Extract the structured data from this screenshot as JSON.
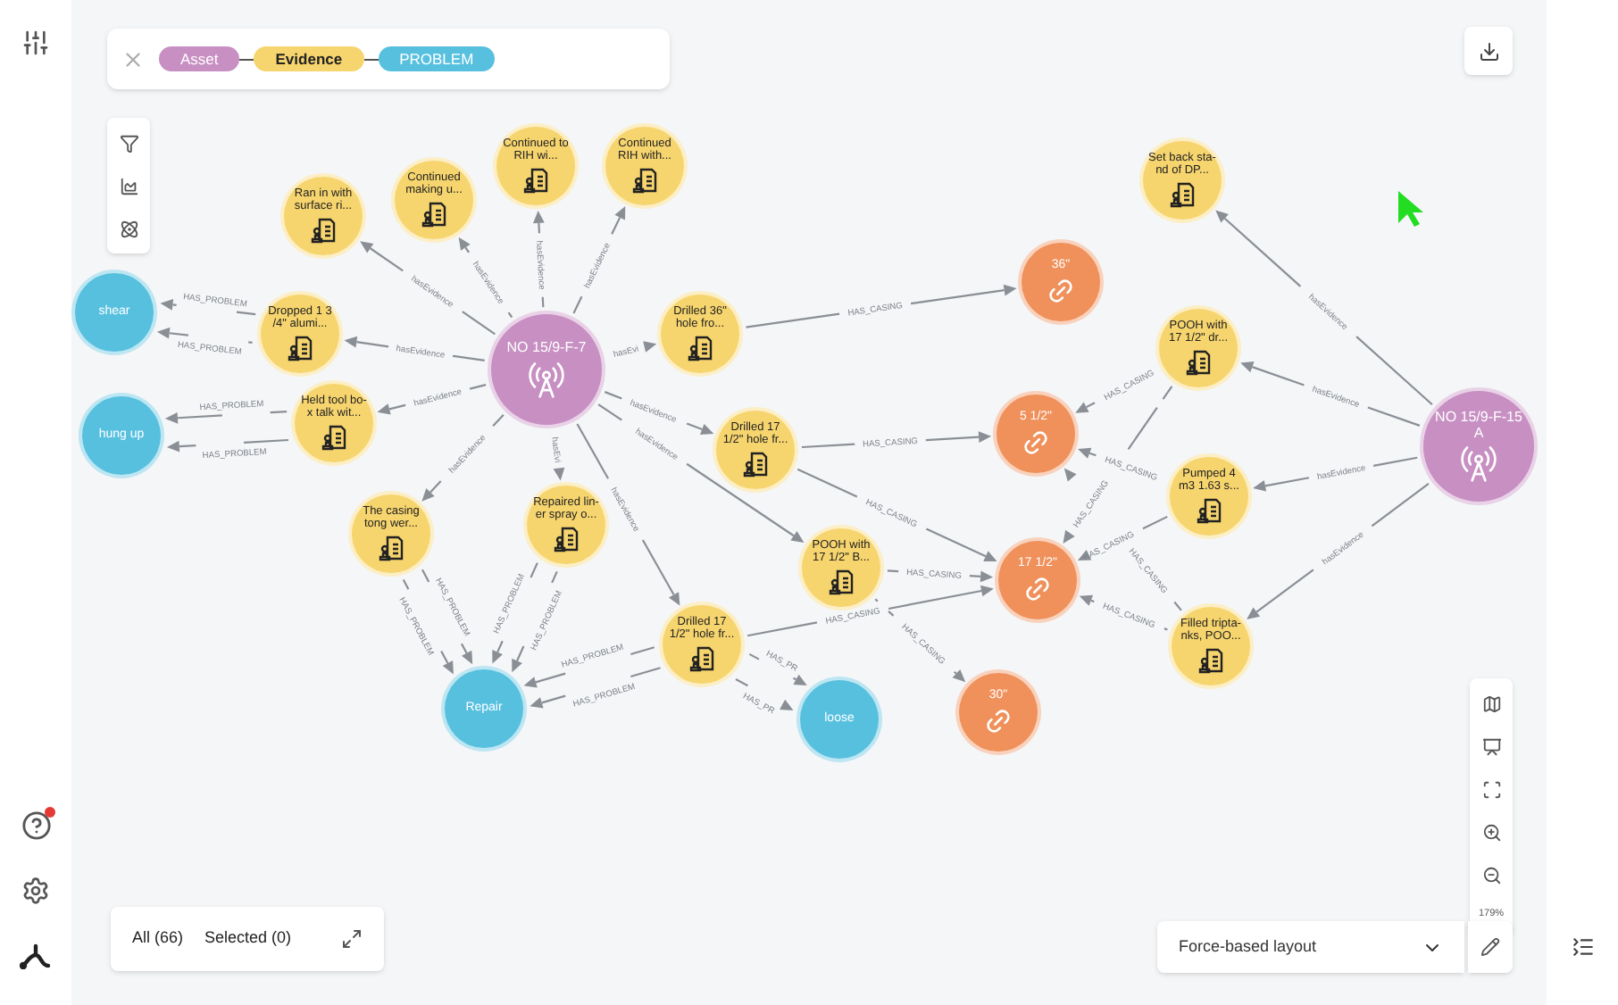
{
  "search_bar": {
    "pills": [
      {
        "label": "Asset",
        "color": "#c78fc2"
      },
      {
        "label": "Evidence",
        "color": "#f7d56e"
      },
      {
        "label": "PROBLEM",
        "color": "#57c0df"
      }
    ]
  },
  "graph": {
    "nodes": [
      {
        "kind": "asset",
        "label": "NO 15/9-F-7"
      },
      {
        "kind": "asset",
        "label": "NO 15/9-F-15 A"
      },
      {
        "kind": "evidence",
        "label": "Ran in with surface ri..."
      },
      {
        "kind": "evidence",
        "label": "Continued making u..."
      },
      {
        "kind": "evidence",
        "label": "Continued to RIH wi..."
      },
      {
        "kind": "evidence",
        "label": "Continued RIH with..."
      },
      {
        "kind": "evidence",
        "label": "Dropped 1 3 /4\" alumi..."
      },
      {
        "kind": "evidence",
        "label": "Held tool bo-x talk wit..."
      },
      {
        "kind": "evidence",
        "label": "Drilled 36\" hole fro..."
      },
      {
        "kind": "evidence",
        "label": "Drilled 17 1/2\" hole fr..."
      },
      {
        "kind": "evidence",
        "label": "The casing tong wer..."
      },
      {
        "kind": "evidence",
        "label": "Repaired lin-er spray o..."
      },
      {
        "kind": "evidence",
        "label": "POOH with 17 1/2\" B..."
      },
      {
        "kind": "evidence",
        "label": "Drilled 17 1/2\" hole fr..."
      },
      {
        "kind": "evidence",
        "label": "Set back sta-nd of DP..."
      },
      {
        "kind": "evidence",
        "label": "POOH with 17 1/2\" dr..."
      },
      {
        "kind": "evidence",
        "label": "Pumped 4 m3 1.63 s..."
      },
      {
        "kind": "evidence",
        "label": "Filled tripta-nks, POO..."
      },
      {
        "kind": "problem",
        "label": "shear"
      },
      {
        "kind": "problem",
        "label": "hung up"
      },
      {
        "kind": "problem",
        "label": "Repair"
      },
      {
        "kind": "problem",
        "label": "loose"
      },
      {
        "kind": "casing",
        "label": "36\""
      },
      {
        "kind": "casing",
        "label": "5 1/2\""
      },
      {
        "kind": "casing",
        "label": "17 1/2\""
      },
      {
        "kind": "casing",
        "label": "30\""
      }
    ],
    "edges": [
      {
        "label": "hasEvidence"
      },
      {
        "label": "hasEvidence"
      },
      {
        "label": "hasEvidence"
      },
      {
        "label": "hasEvidence"
      },
      {
        "label": "hasEvidence"
      },
      {
        "label": "hasEvidence"
      },
      {
        "label": "hasEvi"
      },
      {
        "label": "hasEvidence"
      },
      {
        "label": "hasEvidence"
      },
      {
        "label": "hasEvi"
      },
      {
        "label": "hasEvidence"
      },
      {
        "label": "hasEvidence"
      },
      {
        "label": "hasEvidence"
      },
      {
        "label": "hasEvidence"
      },
      {
        "label": "hasEvidence"
      },
      {
        "label": "hasEvidence"
      },
      {
        "label": "HAS_PROBLEM"
      },
      {
        "label": "HAS_PROBLEM"
      },
      {
        "label": "HAS_PROBLEM"
      },
      {
        "label": "HAS_PROBLEM"
      },
      {
        "label": "HAS_PROBLEM"
      },
      {
        "label": "HAS_PROBLEM"
      },
      {
        "label": "HAS_PROBLEM"
      },
      {
        "label": "HAS_PROBLEM"
      },
      {
        "label": "HAS_PROBLEM"
      },
      {
        "label": "HAS_PROBLEM"
      },
      {
        "label": "HAS_PR"
      },
      {
        "label": "HAS_PR"
      },
      {
        "label": "HAS_CASING"
      },
      {
        "label": "HAS_CASING"
      },
      {
        "label": "HAS_CASING"
      },
      {
        "label": "HAS_CASING"
      },
      {
        "label": "HAS_CASING"
      },
      {
        "label": "HAS_CASING"
      },
      {
        "label": "HAS_CASING"
      },
      {
        "label": "HAS_CASING"
      },
      {
        "label": "HAS_CASING"
      },
      {
        "label": "HAS_CASING"
      },
      {
        "label": "HAS_CASING"
      },
      {
        "label": "HAS_CASING"
      }
    ]
  },
  "zoom_level": "179%",
  "selection": {
    "all": "All (66)",
    "selected": "Selected (0)"
  },
  "layout_select": {
    "value": "Force-based layout"
  }
}
